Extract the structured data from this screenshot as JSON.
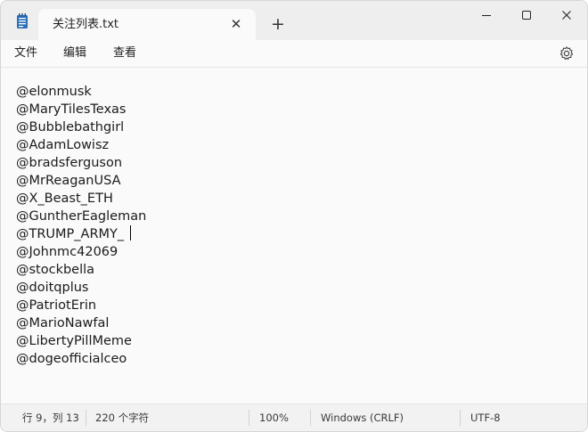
{
  "tab": {
    "title": "关注列表.txt"
  },
  "menu": {
    "file": "文件",
    "edit": "编辑",
    "view": "查看"
  },
  "window_controls": {
    "minimize": "—",
    "maximize": "☐",
    "close": "✕",
    "new_tab": "+",
    "tab_close": "✕"
  },
  "editor": {
    "lines": [
      "@elonmusk",
      "@MaryTilesTexas",
      "@Bubblebathgirl",
      "@AdamLowisz",
      "@bradsferguson",
      "@MrReaganUSA",
      "@X_Beast_ETH",
      "@GuntherEagleman",
      "@TRUMP_ARMY_",
      "@Johnmc42069",
      "@stockbella",
      "@doitqplus",
      "@PatriotErin",
      "@MarioNawfal",
      "@LibertyPillMeme",
      "@dogeofficialceo"
    ],
    "caret_line": 9,
    "caret_column": 13
  },
  "status": {
    "position": "行 9，列 13",
    "char_count": "220 个字符",
    "zoom": "100%",
    "line_ending": "Windows (CRLF)",
    "encoding": "UTF-8"
  },
  "icons": {
    "app": "notepad-icon",
    "settings": "gear-icon"
  },
  "colors": {
    "titlebar": "#eeeeee",
    "editor_bg": "#fafafa",
    "statusbar": "#f2f2f2",
    "app_icon": "#2a6fb8"
  }
}
